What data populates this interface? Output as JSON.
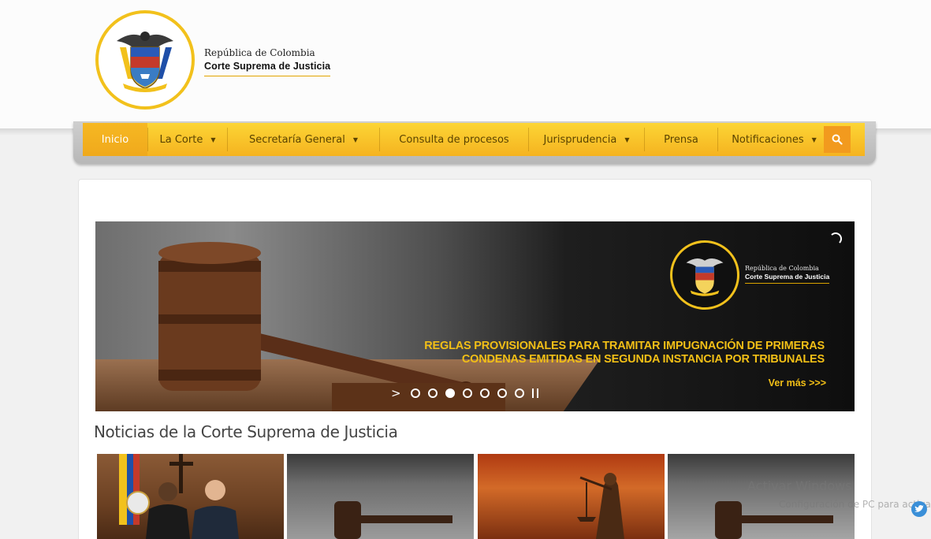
{
  "header": {
    "line1": "República de Colombia",
    "line2": "Corte Suprema de Justicia",
    "seal_icon": "coat-of-arms-icon"
  },
  "nav": {
    "items": [
      {
        "label": "Inicio",
        "active": true,
        "dropdown": false
      },
      {
        "label": "La Corte",
        "dropdown": true
      },
      {
        "label": "Secretaría General",
        "dropdown": true
      },
      {
        "label": "Consulta de procesos",
        "dropdown": false
      },
      {
        "label": "Jurisprudencia",
        "dropdown": true
      },
      {
        "label": "Prensa",
        "dropdown": false
      },
      {
        "label": "Notificaciones",
        "dropdown": true
      }
    ],
    "search_icon": "search-icon"
  },
  "slider": {
    "brand_line1": "República de Colombia",
    "brand_line2": "Corte Suprema de Justicia",
    "headline_line1": "REGLAS PROVISIONALES PARA TRAMITAR IMPUGNACIÓN DE PRIMERAS",
    "headline_line2": "CONDENAS EMITIDAS EN SEGUNDA INSTANCIA POR TRIBUNALES",
    "cta": "Ver más  >>>",
    "dots_total": 7,
    "active_dot": 3
  },
  "news": {
    "title": "Noticias de la Corte Suprema de Justicia"
  },
  "watermark": {
    "line1": "Activar Windows",
    "line2": "Configuración de PC para activar"
  },
  "colors": {
    "accent_yellow": "#f5b320",
    "headline_yellow": "#f2bf16",
    "search_orange": "#f29a1e"
  }
}
